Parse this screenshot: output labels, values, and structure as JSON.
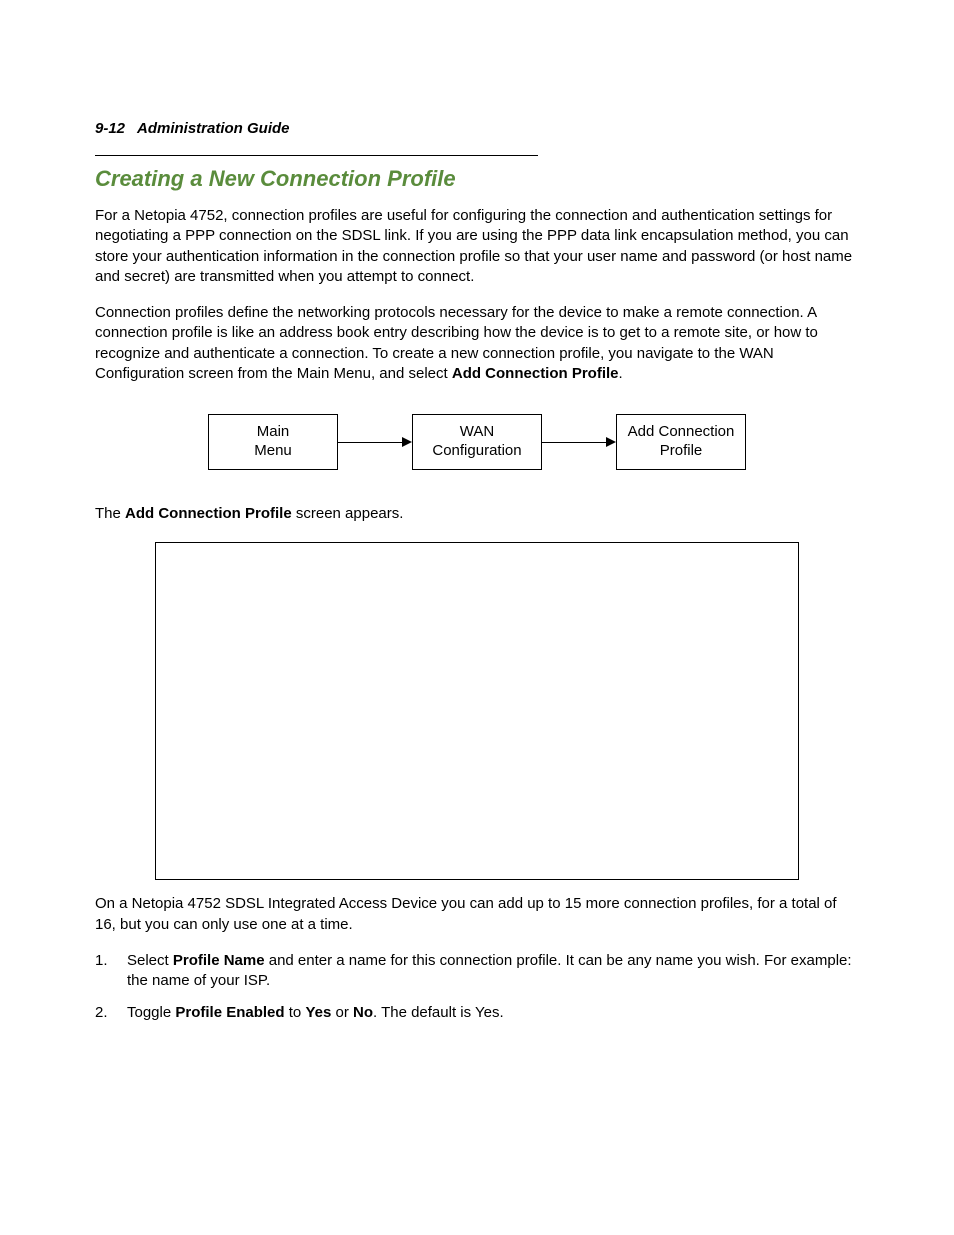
{
  "header": {
    "page_num": "9-12",
    "guide_name": "Administration Guide"
  },
  "section": {
    "title": "Creating a New Connection Profile"
  },
  "paragraphs": {
    "p1": "For a Netopia 4752, connection profiles are useful for configuring the connection and authentication settings for negotiating a PPP connection on the SDSL link. If you are using the PPP data link encapsulation method, you can store your authentication information in the connection profile so that your user name and password (or host name and secret) are transmitted when you attempt to connect.",
    "p2_a": "Connection profiles define the networking protocols necessary for the device to make a remote connection. A connection profile is like an address book entry describing how the device is to get to a remote site, or how to recognize and authenticate a connection. To create a new connection profile, you navigate to the WAN Configuration screen from the Main Menu, and select ",
    "p2_bold": "Add Connection Profile",
    "p2_b": ".",
    "p3_a": "The ",
    "p3_bold": "Add Connection Profile",
    "p3_b": " screen appears.",
    "p4": "On a Netopia 4752 SDSL Integrated Access Device you can add up to 15 more connection profiles, for a total of 16, but you can only use one at a time."
  },
  "flow": {
    "box1": "Main\nMenu",
    "box2": "WAN\nConfiguration",
    "box3": "Add Connection\nProfile"
  },
  "steps": {
    "s1_a": "Select ",
    "s1_bold": "Profile Name",
    "s1_b": " and enter a name for this connection profile. It can be any name you wish. For example: the name of your ISP.",
    "s2_a": "Toggle ",
    "s2_bold1": "Profile Enabled",
    "s2_b": " to ",
    "s2_bold2": "Yes",
    "s2_c": " or ",
    "s2_bold3": "No",
    "s2_d": ". The default is Yes."
  }
}
